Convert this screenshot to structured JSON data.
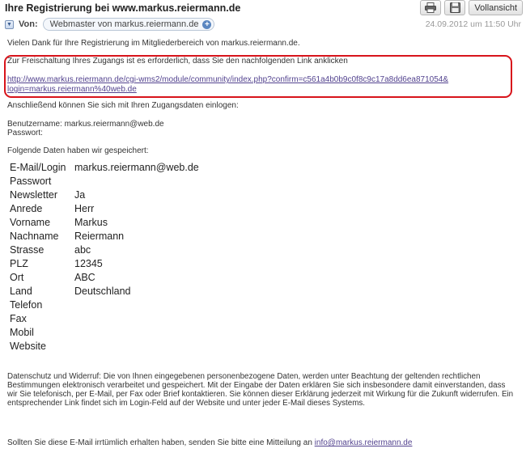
{
  "header": {
    "subject": "Ihre Registrierung bei www.markus.reiermann.de",
    "from_label": "Von:",
    "sender": "Webmaster von markus.reiermann.de",
    "date": "24.09.2012 um 11:50 Uhr",
    "fullview_label": "Vollansicht"
  },
  "body": {
    "greeting": "Vielen Dank für Ihre Registrierung im Mitgliederbereich von markus.reiermann.de.",
    "activation_text": "Zur Freischaltung Ihres Zugangs ist es erforderlich, dass Sie den nachfolgenden Link anklicken",
    "activation_link_line1": "http://www.markus.reiermann.de/cgi-wms2/module/community/index.php?confirm=c561a4b0b9c0f8c9c17a8dd6ea871054&",
    "activation_link_line2": "login=markus.reiermann%40web.de",
    "login_text": "Anschließend können Sie sich mit Ihren Zugangsdaten einlogen:",
    "username_line": "Benutzername: markus.reiermann@web.de",
    "password_line": "Passwort:",
    "saved_text": "Folgende Daten haben wir gespeichert:",
    "fields": [
      {
        "label": "E-Mail/Login",
        "value": "markus.reiermann@web.de"
      },
      {
        "label": "Passwort",
        "value": ""
      },
      {
        "label": "Newsletter",
        "value": "Ja"
      },
      {
        "label": "Anrede",
        "value": "Herr"
      },
      {
        "label": "Vorname",
        "value": "Markus"
      },
      {
        "label": "Nachname",
        "value": "Reiermann"
      },
      {
        "label": "Strasse",
        "value": "abc"
      },
      {
        "label": "PLZ",
        "value": "12345"
      },
      {
        "label": "Ort",
        "value": "ABC"
      },
      {
        "label": "Land",
        "value": "Deutschland"
      },
      {
        "label": "Telefon",
        "value": ""
      },
      {
        "label": "Fax",
        "value": ""
      },
      {
        "label": "Mobil",
        "value": ""
      },
      {
        "label": "Website",
        "value": ""
      }
    ],
    "privacy_text": "Datenschutz und Widerruf: Die von Ihnen eingegebenen personenbezogene Daten, werden unter Beachtung der geltenden rechtlichen Bestimmungen elektronisch verarbeitet und gespeichert. Mit der Eingabe der Daten erklären Sie sich insbesondere damit einverstanden, dass wir Sie telefonisch, per E-Mail, per Fax oder Brief kontaktieren. Sie können dieser Erklärung jederzeit mit Wirkung für die Zukunft widerrufen. Ein entsprechender Link findet sich im Login-Feld auf der Website und unter jeder E-Mail dieses Systems.",
    "footer_text": "Sollten Sie diese E-Mail irrtümlich erhalten haben, senden Sie bitte eine Mitteilung an ",
    "footer_email": "info@markus.reiermann.de"
  },
  "icons": {
    "print": "print-icon",
    "save": "save-icon",
    "collapse": "chevron-down-icon",
    "add_contact": "plus-icon"
  }
}
